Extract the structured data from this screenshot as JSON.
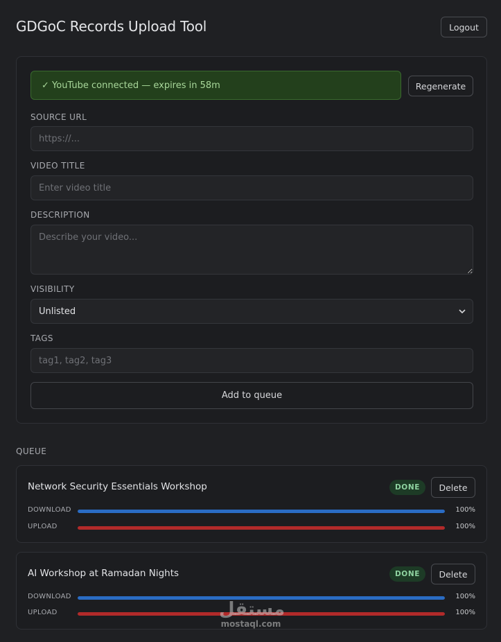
{
  "header": {
    "title": "GDGoC Records Upload Tool",
    "logout_label": "Logout"
  },
  "status": {
    "message": "✓ YouTube connected — expires in 58m",
    "regenerate_label": "Regenerate"
  },
  "form": {
    "source_url": {
      "label": "SOURCE URL",
      "placeholder": "https://...",
      "value": ""
    },
    "video_title": {
      "label": "VIDEO TITLE",
      "placeholder": "Enter video title",
      "value": ""
    },
    "description": {
      "label": "DESCRIPTION",
      "placeholder": "Describe your video...",
      "value": ""
    },
    "visibility": {
      "label": "VISIBILITY",
      "selected": "Unlisted"
    },
    "tags": {
      "label": "TAGS",
      "placeholder": "tag1, tag2, tag3",
      "value": ""
    },
    "submit_label": "Add to queue"
  },
  "queue": {
    "heading": "QUEUE",
    "items": [
      {
        "title": "Network Security Essentials Workshop",
        "status": "DONE",
        "delete_label": "Delete",
        "download": {
          "label": "DOWNLOAD",
          "percent": 100,
          "percent_text": "100%"
        },
        "upload": {
          "label": "UPLOAD",
          "percent": 100,
          "percent_text": "100%"
        }
      },
      {
        "title": "AI Workshop at Ramadan Nights",
        "status": "DONE",
        "delete_label": "Delete",
        "download": {
          "label": "DOWNLOAD",
          "percent": 100,
          "percent_text": "100%"
        },
        "upload": {
          "label": "UPLOAD",
          "percent": 100,
          "percent_text": "100%"
        }
      }
    ]
  },
  "watermark": {
    "arabic": "مستقل",
    "latin": "mostaql.com"
  },
  "colors": {
    "download_bar": "#2a6cc4",
    "upload_bar": "#b22a2a",
    "status_bg": "#23401c",
    "badge_done": "#8fd3a1"
  }
}
